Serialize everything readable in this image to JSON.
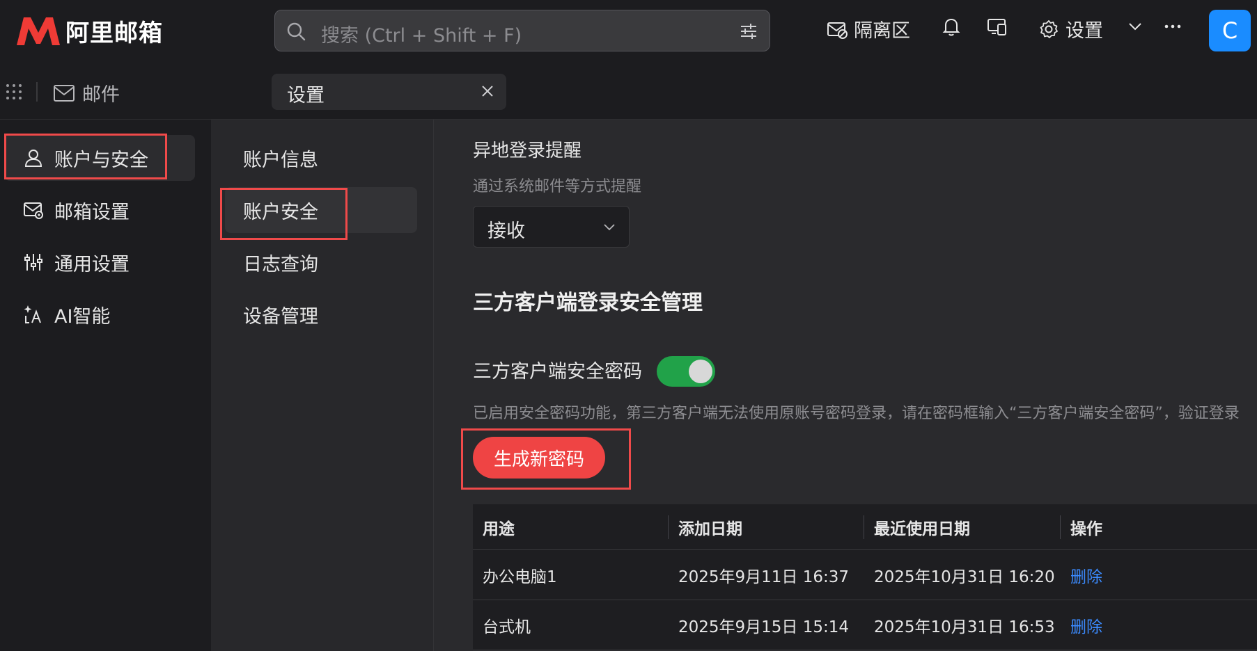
{
  "header": {
    "brand": "阿里邮箱",
    "search_placeholder": "搜索 (Ctrl + Shift + F)",
    "quarantine_label": "隔离区",
    "settings_label": "设置",
    "avatar_letter": "C"
  },
  "tabs": {
    "mail_label": "邮件",
    "settings_tab_label": "设置"
  },
  "left_nav": {
    "items": [
      {
        "label": "账户与安全",
        "icon": "user-icon"
      },
      {
        "label": "邮箱设置",
        "icon": "mailbox-settings-icon"
      },
      {
        "label": "通用设置",
        "icon": "sliders-icon"
      },
      {
        "label": "AI智能",
        "icon": "ai-icon"
      }
    ],
    "active_index": 0
  },
  "sub_nav": {
    "items": [
      {
        "label": "账户信息"
      },
      {
        "label": "账户安全"
      },
      {
        "label": "日志查询"
      },
      {
        "label": "设备管理"
      }
    ],
    "active_index": 1
  },
  "main": {
    "remote_login": {
      "title": "异地登录提醒",
      "desc": "通过系统邮件等方式提醒",
      "select_value": "接收"
    },
    "third_party": {
      "title": "三方客户端登录安全管理",
      "pw_label": "三方客户端安全密码",
      "toggle_on": true,
      "desc": "已启用安全密码功能，第三方客户端无法使用原账号密码登录，请在密码框输入“三方客户端安全密码”，验证登录",
      "generate_label": "生成新密码"
    },
    "table": {
      "headers": [
        "用途",
        "添加日期",
        "最近使用日期",
        "操作"
      ],
      "rows": [
        {
          "purpose": "办公电脑1",
          "added": "2025年9月11日 16:37",
          "last_used": "2025年10月31日 16:20",
          "action": "删除"
        },
        {
          "purpose": "台式机",
          "added": "2025年9月15日 15:14",
          "last_used": "2025年10月31日 16:53",
          "action": "删除"
        }
      ]
    }
  },
  "colors": {
    "accent_red": "#ef4444",
    "highlight_red": "#f04a4a",
    "toggle_green": "#21a249",
    "link_blue": "#3b8bff",
    "avatar_blue": "#1a8cff"
  }
}
